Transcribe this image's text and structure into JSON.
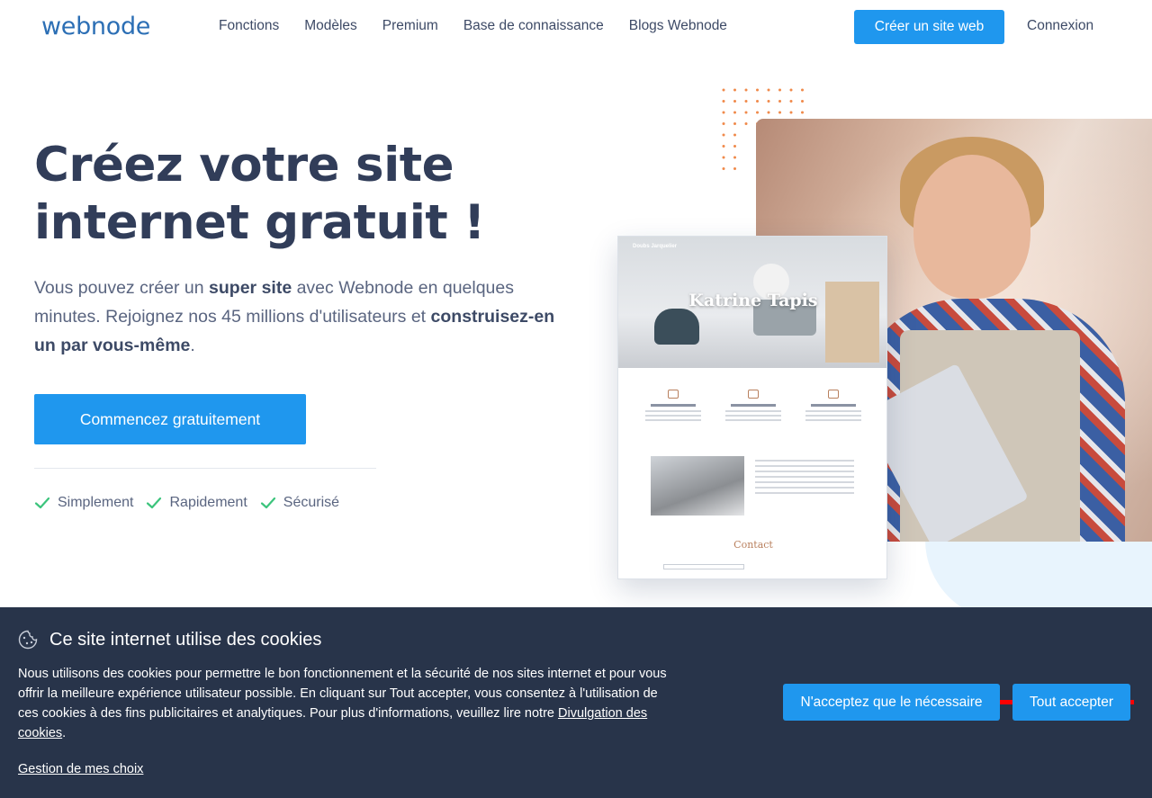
{
  "header": {
    "logo": "webnode",
    "nav": [
      "Fonctions",
      "Modèles",
      "Premium",
      "Base de connaissance",
      "Blogs Webnode"
    ],
    "create_label": "Créer un site web",
    "login_label": "Connexion"
  },
  "hero": {
    "title": "Créez votre site internet gratuit !",
    "subtitle_parts": {
      "p1": "Vous pouvez créer un ",
      "b1": "super site",
      "p2": " avec Webnode en quelques minutes. Rejoignez nos 45 millions d'utilisateurs et ",
      "b2": "construisez-en un par vous-même",
      "p3": "."
    },
    "cta_label": "Commencez gratuitement",
    "features": [
      "Simplement",
      "Rapidement",
      "Sécurisé"
    ]
  },
  "mockup": {
    "brand": "Doubs Jarquelier",
    "title": "Katrine Tapis",
    "contact": "Contact"
  },
  "cookie": {
    "title": "Ce site internet utilise des cookies",
    "text": "Nous utilisons des cookies pour permettre le bon fonctionnement et la sécurité de nos sites internet et pour vous offrir la meilleure expérience utilisateur possible. En cliquant sur Tout accepter, vous consentez à l'utilisation de ces cookies à des fins publicitaires et analytiques. Pour plus d'informations, veuillez lire notre ",
    "link_label": "Divulgation des cookies",
    "text_end": ".",
    "manage_label": "Gestion de mes choix",
    "necessary_label": "N'acceptez que le nécessaire",
    "accept_label": "Tout accepter"
  },
  "colors": {
    "accent": "#1f97ee",
    "banner": "#28344a",
    "check": "#3cc47c",
    "title": "#313d59"
  },
  "icons": {
    "check": "check-icon",
    "cookie": "cookie-icon"
  }
}
